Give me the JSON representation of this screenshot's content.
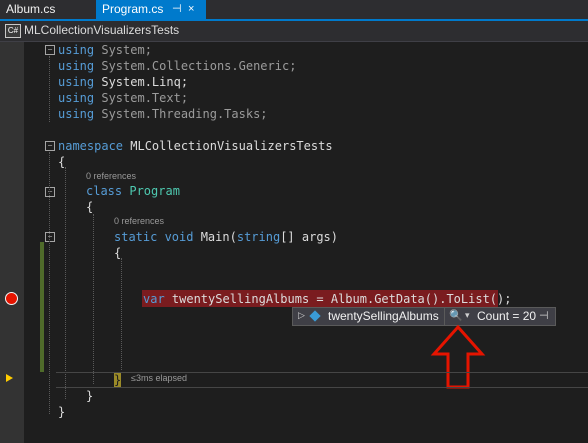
{
  "tabs": [
    {
      "label": "Album.cs"
    },
    {
      "label": "Program.cs",
      "pin": "⊣",
      "close": "×"
    }
  ],
  "nav": {
    "icon": "C#",
    "project": "MLCollectionVisualizersTests"
  },
  "code": {
    "l1": {
      "kw": "using",
      "rest": " System;"
    },
    "l2": {
      "kw": "using",
      "rest": " System.Collections.Generic;"
    },
    "l3": {
      "kw": "using",
      "rest": " System.Linq;"
    },
    "l4": {
      "kw": "using",
      "rest": " System.Text;"
    },
    "l5": {
      "kw": "using",
      "rest": " System.Threading.Tasks;"
    },
    "ns": {
      "kw": "namespace",
      "rest": " MLCollectionVisualizersTests"
    },
    "ob1": "{",
    "ref1": "0 references",
    "cls": {
      "kw": "class",
      "name": " Program"
    },
    "ob2": "{",
    "ref2": "0 references",
    "main": {
      "k1": "static",
      "k2": " void",
      "n": " Main(",
      "k3": "string",
      "r": "[] args)"
    },
    "ob3": "{",
    "stmt": {
      "k": "var",
      "r": " twentySellingAlbums = Album.GetData().ToList();"
    },
    "cb3": "}",
    "elapsed": "≤3ms elapsed",
    "cb2": "}",
    "cb1": "}"
  },
  "datatip": {
    "expand": "▷",
    "name": "twentySellingAlbums",
    "magnifier": "🔍",
    "dropdown": "▾",
    "value": "Count = 20",
    "pin": "⊣"
  },
  "colors": {
    "accent": "#007acc",
    "arrow": "#e51400",
    "breakpoint": "#e51400",
    "highlight": "#7a1c1f"
  }
}
